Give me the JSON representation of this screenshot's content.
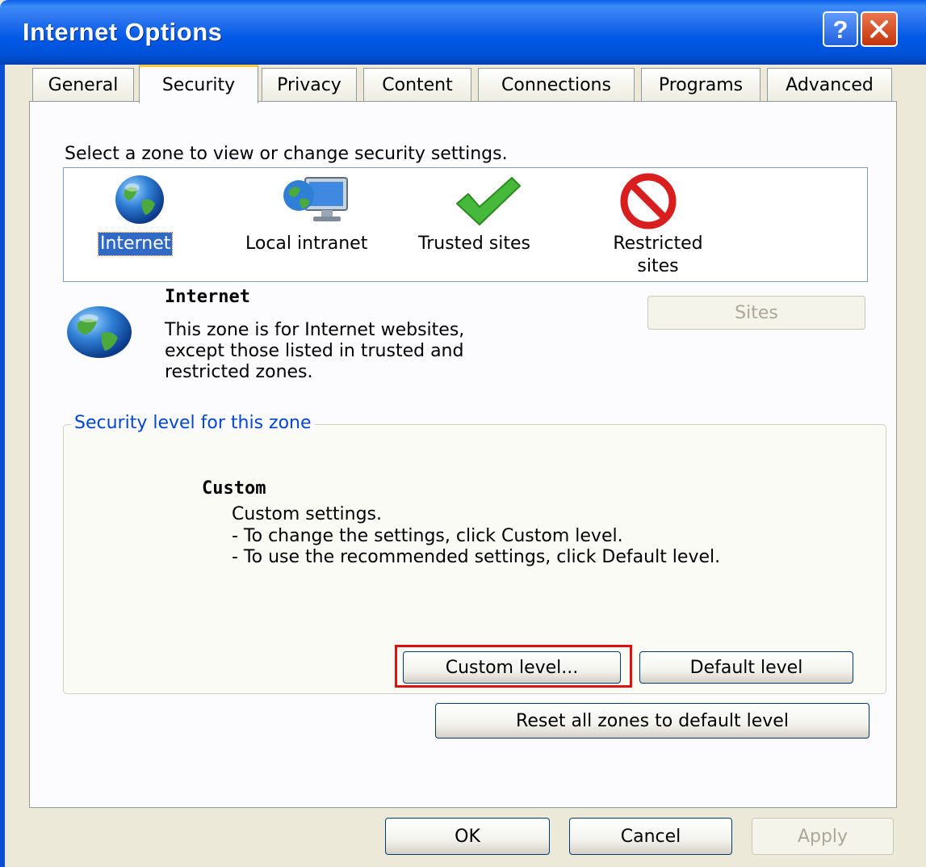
{
  "window": {
    "title": "Internet Options",
    "help_label": "?",
    "accent_color": "#0054e3"
  },
  "tabs": [
    {
      "label": "General"
    },
    {
      "label": "Security",
      "active": true
    },
    {
      "label": "Privacy"
    },
    {
      "label": "Content"
    },
    {
      "label": "Connections"
    },
    {
      "label": "Programs"
    },
    {
      "label": "Advanced"
    }
  ],
  "security": {
    "select_prompt": "Select a zone to view or change security settings.",
    "zones": [
      {
        "label": "Internet",
        "icon": "globe-icon",
        "selected": true
      },
      {
        "label": "Local intranet",
        "icon": "computer-globe-icon"
      },
      {
        "label": "Trusted sites",
        "icon": "checkmark-icon"
      },
      {
        "label_line1": "Restricted",
        "label_line2": "sites",
        "icon": "no-entry-icon"
      }
    ],
    "zone_name": "Internet",
    "zone_desc_1": "This zone is for Internet websites,",
    "zone_desc_2": "except those listed in trusted and",
    "zone_desc_3": "restricted zones.",
    "sites_button": "Sites",
    "level_group_title": "Security level for this zone",
    "level_name": "Custom",
    "level_desc_1": "Custom settings.",
    "level_desc_2": "- To change the settings, click Custom level.",
    "level_desc_3": "- To use the recommended settings, click Default level.",
    "custom_level_button": "Custom level...",
    "default_level_button": "Default level",
    "reset_all_button": "Reset all zones to default level"
  },
  "footer": {
    "ok": "OK",
    "cancel": "Cancel",
    "apply": "Apply"
  }
}
